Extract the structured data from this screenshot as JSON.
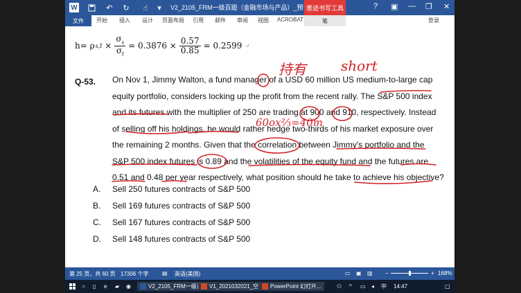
{
  "titlebar": {
    "title": "V2_2105_FRM一级百题（金融市场与产品）_预课版 - Micro...",
    "ink_tools": "墨迹书写工具",
    "help": "?",
    "ribbon_toggle": "▣",
    "minimize": "—",
    "restore": "❐",
    "close": "✕",
    "save_icon": "floppy-icon",
    "undo_icon": "undo-icon",
    "redo_icon": "redo-icon"
  },
  "ribbon": {
    "file": "文件",
    "tabs": [
      "开始",
      "插入",
      "设计",
      "页面布局",
      "引用",
      "邮件",
      "审阅",
      "视图",
      "ACROBAT"
    ],
    "pen": "笔",
    "login": "登录"
  },
  "doc": {
    "formula": {
      "lhs": "h= ρ",
      "sub": "s,f",
      "times": "×",
      "sigma_num": "σ",
      "sigma_num_sub": "s",
      "sigma_den": "σ",
      "sigma_den_sub": "f",
      "eq1": "= 0.3876 ×",
      "num2": "0.57",
      "den2": "0.85",
      "eq2": "= 0.2599",
      "para_mark": "↵"
    },
    "question_label": "Q-53.",
    "question_lines": [
      "On Nov 1, Jimmy Walton, a fund manager of a USD 60 million US medium-to-large cap",
      "equity portfolio, considers locking up the profit from the recent rally. The S&P 500 index",
      "and its futures with the multiplier of 250 are trading at 900 and 910, respectively. Instead",
      "of selling off his holdings, he would rather hedge two-thirds of his market exposure over",
      "the remaining 2 months. Given that the correlation between Jimmy's portfolio and the",
      "S&P 500 index futures is 0.89 and the volatilities of the equity fund and the futures are",
      "0.51 and 0.48 per year respectively, what position should he take to achieve his objective?"
    ],
    "options": [
      {
        "letter": "A.",
        "text": "Sell 250 futures contracts of S&P 500"
      },
      {
        "letter": "B.",
        "text": "Sell 169 futures contracts of S&P 500"
      },
      {
        "letter": "C.",
        "text": "Sell 167 futures contracts of S&P 500"
      },
      {
        "letter": "D.",
        "text": "Sell 148 futures contracts of S&P 500"
      }
    ],
    "handwriting": {
      "note1": "持有",
      "note2": "short",
      "note3": "60ox⅔=40m"
    }
  },
  "statusbar": {
    "page": "第 25 页，共 60 页",
    "words": "17306 个字",
    "lang": "英语(美国)",
    "zoom": "168%",
    "zoom_minus": "−",
    "zoom_plus": "+"
  },
  "taskbar": {
    "app1": "V2_2105_FRM一级百...",
    "app2": "V1_2021032021_空...",
    "app3": "PowerPoint 幻灯片...",
    "ime": "中",
    "clock": "14:47"
  },
  "colors": {
    "word_blue": "#2b579a",
    "ink_red": "#d2222a",
    "ink_tools_red": "#e23a3a"
  }
}
